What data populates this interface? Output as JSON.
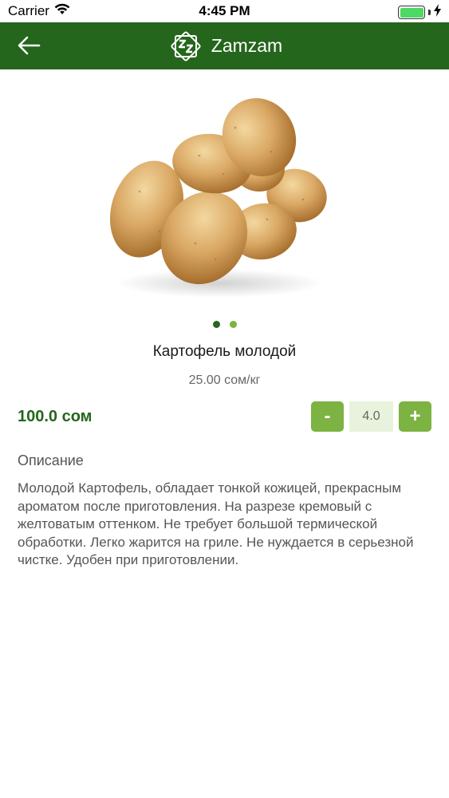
{
  "status_bar": {
    "carrier": "Carrier",
    "time": "4:45 PM"
  },
  "header": {
    "back_icon": "arrow-left-icon",
    "logo_icon": "zamzam-logo-icon",
    "title": "Zamzam",
    "background_color": "#24661c"
  },
  "product": {
    "image": "potatoes-photo",
    "gallery": {
      "page_count": 2,
      "active_index": 0
    },
    "name": "Картофель молодой",
    "unit_price": "25.00 сом/кг",
    "total_price": "100.0 сом",
    "quantity": "4.0",
    "decrement_label": "-",
    "increment_label": "+",
    "accent_color": "#7cb342"
  },
  "description": {
    "heading": "Описание",
    "text": "Молодой Картофель, обладает тонкой кожицей, прекрасным ароматом после приготовления. На разрезе кремовый с желтоватым оттенком. Не требует большой термической обработки. Легко жарится на гриле. Не нуждается в серьезной чистке. Удобен при приготовлении."
  }
}
